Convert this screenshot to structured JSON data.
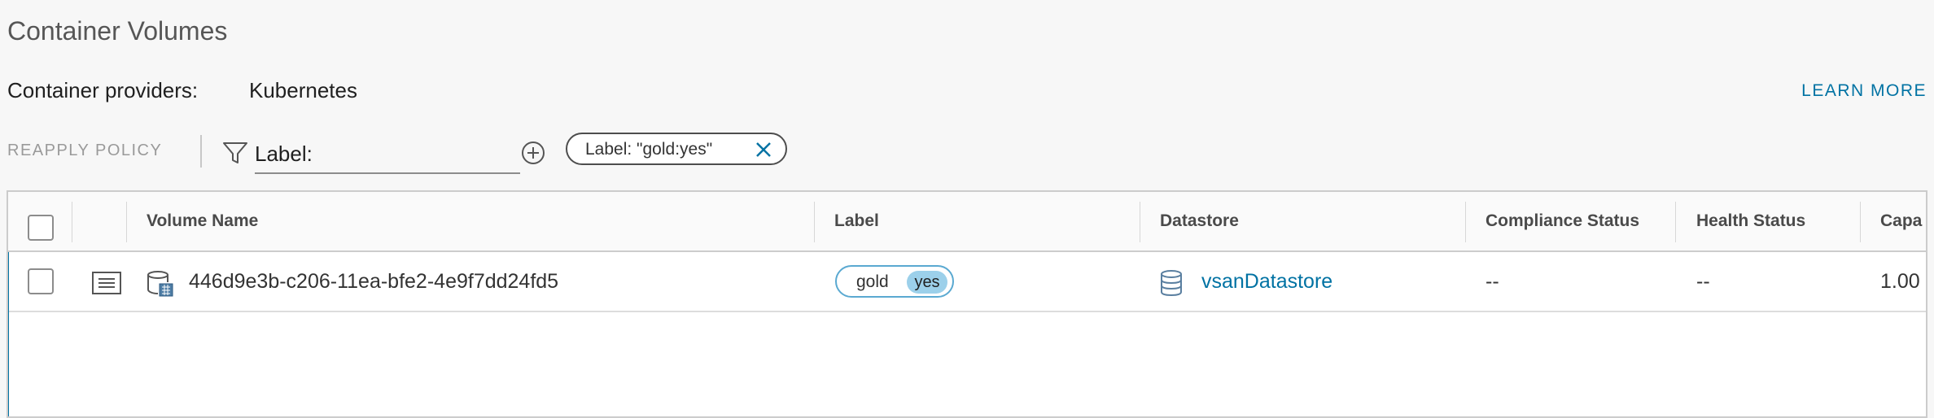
{
  "page": {
    "title": "Container Volumes"
  },
  "providers": {
    "label": "Container providers:",
    "value": "Kubernetes",
    "learn_more": "LEARN MORE"
  },
  "toolbar": {
    "reapply_label": "REAPPLY POLICY",
    "filter_key": "Label:",
    "filter_chip": "Label: \"gold:yes\""
  },
  "grid": {
    "columns": [
      "Volume Name",
      "Label",
      "Datastore",
      "Compliance Status",
      "Health Status",
      "Capa"
    ],
    "rows": [
      {
        "volume_name": "446d9e3b-c206-11ea-bfe2-4e9f7dd24fd5",
        "label_key": "gold",
        "label_value": "yes",
        "datastore": "vsanDatastore",
        "compliance": "--",
        "health": "--",
        "capacity": "1.00"
      }
    ]
  },
  "colors": {
    "accent": "#0072a3",
    "label_value_bg": "#9cd0ea"
  },
  "icons": [
    "filter-icon",
    "add-icon",
    "close-icon",
    "details-icon",
    "volume-icon",
    "datastore-icon"
  ]
}
